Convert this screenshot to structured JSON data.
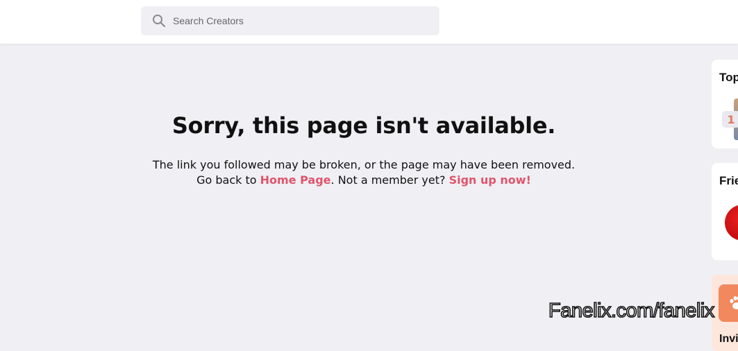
{
  "header": {
    "search": {
      "placeholder": "Search Creators",
      "icon": "search-icon"
    }
  },
  "error": {
    "title": "Sorry, this page isn't available.",
    "message_part1": "The link you followed may be broken, or the page may have been removed. Go back to ",
    "home_link": "Home Page",
    "message_part2": ". Not a member yet? ",
    "signup_link": "Sign up now!"
  },
  "sidebar": {
    "top_card": {
      "title": "Top",
      "rank": "1"
    },
    "friends_card": {
      "title": "Frie"
    },
    "invite_card": {
      "title": "Invi",
      "icon": "paw-icon"
    }
  },
  "watermark": "Fanelix.com/fanelix",
  "colors": {
    "page_background": "#f0f0f4",
    "link": "#e0546b",
    "invite_accent": "#f2885e"
  }
}
